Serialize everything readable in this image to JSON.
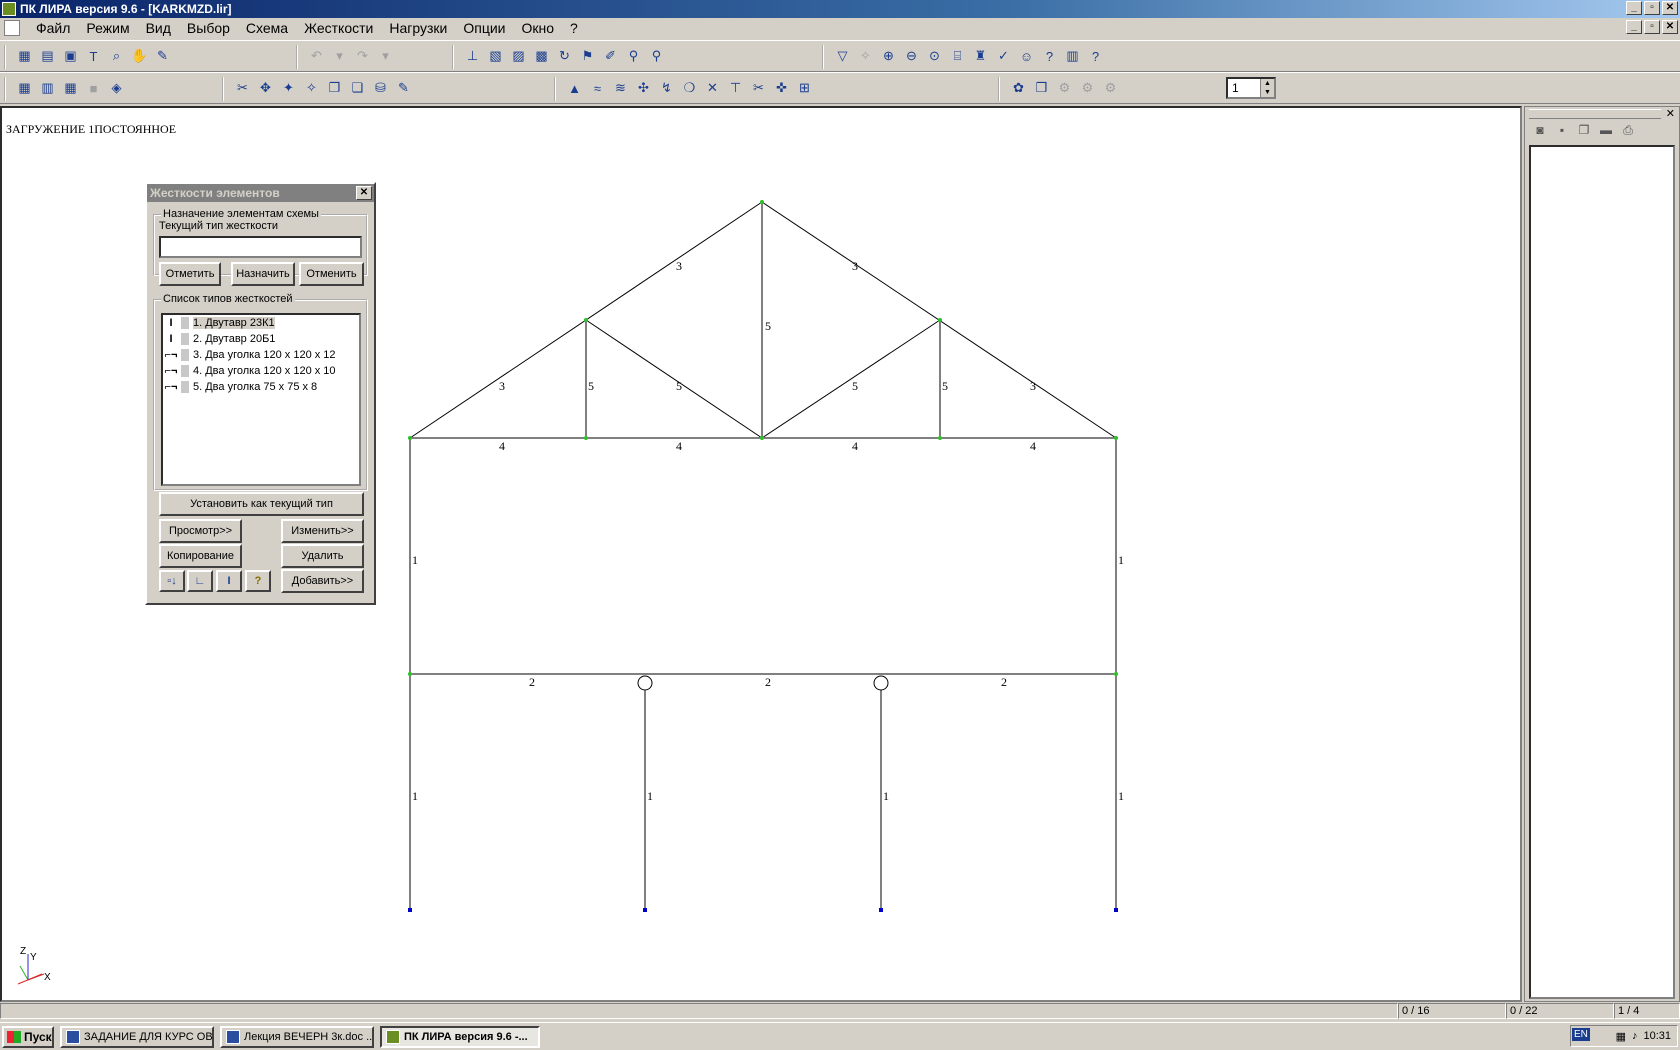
{
  "window": {
    "title": "ПК ЛИРА  версия 9.6 - [KARKMZD.lir]"
  },
  "menu": [
    "Файл",
    "Режим",
    "Вид",
    "Выбор",
    "Схема",
    "Жесткости",
    "Нагрузки",
    "Опции",
    "Окно",
    "?"
  ],
  "toolbar": {
    "spin_value": "1"
  },
  "canvas": {
    "load_title": "ЗАГРУЖЕНИЕ 1ПОСТОЯННОЕ",
    "axis_z": "Z",
    "axis_y": "Y",
    "axis_x": "X"
  },
  "dialog": {
    "title": "Жесткости элементов",
    "assign_group": "Назначение элементам схемы",
    "current_type_label": "Текущий тип жесткости",
    "current_type_value": "",
    "btn_mark": "Отметить",
    "btn_assign": "Назначить",
    "btn_cancel": "Отменить",
    "list_group": "Список типов жесткостей",
    "items": [
      {
        "label": "1. Двутавр 23К1",
        "icon": "I"
      },
      {
        "label": "2. Двутавр 20Б1",
        "icon": "I"
      },
      {
        "label": "3. Два уголка 120 x 120 x 12",
        "icon": "⌐¬"
      },
      {
        "label": "4. Два уголка 120 x 120 x 10",
        "icon": "⌐¬"
      },
      {
        "label": "5. Два уголка 75 x 75 x 8",
        "icon": "⌐¬"
      }
    ],
    "btn_set_current": "Установить как текущий тип",
    "btn_view": "Просмотр>>",
    "btn_edit": "Изменить>>",
    "btn_copy": "Копирование",
    "btn_delete": "Удалить",
    "btn_add": "Добавить>>",
    "btn_help": "?"
  },
  "statusbar": {
    "c1": "0 / 16",
    "c2": "0 / 22",
    "c3": "1 / 4"
  },
  "taskbar": {
    "start": "Пуск",
    "tasks": [
      "ЗАДАНИЕ ДЛЯ КУРС ОВ...",
      "Лекция ВЕЧЕРН 3к.doc ...",
      "ПК ЛИРА  версия 9.6 -..."
    ],
    "lang": "EN",
    "clock": "10:31"
  }
}
